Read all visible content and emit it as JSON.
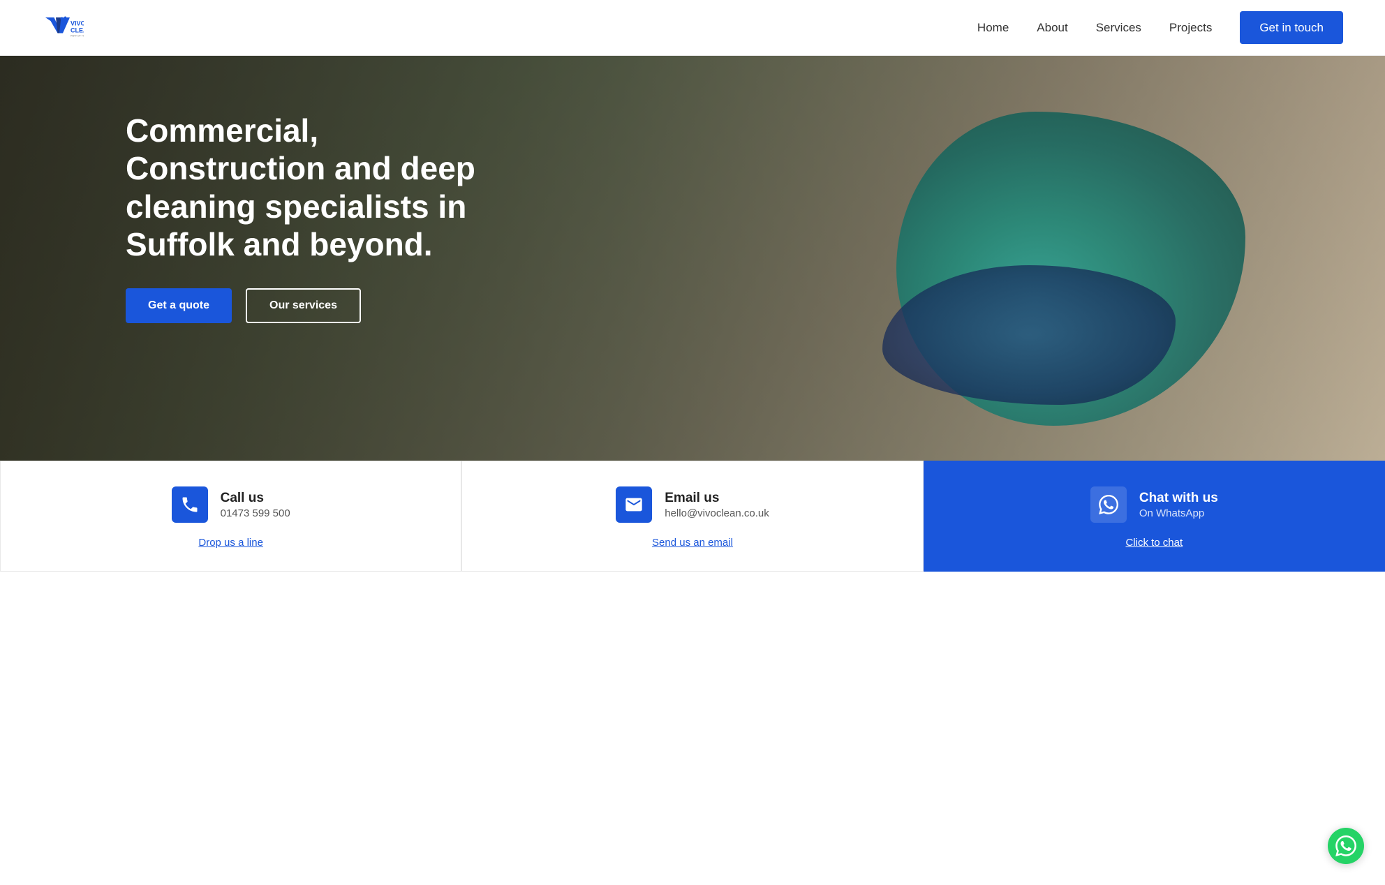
{
  "brand": {
    "name": "VIVO CLEAN",
    "tagline": "PART OF THE VIVO GROUP"
  },
  "nav": {
    "links": [
      {
        "label": "Home",
        "id": "home"
      },
      {
        "label": "About",
        "id": "about"
      },
      {
        "label": "Services",
        "id": "services"
      },
      {
        "label": "Projects",
        "id": "projects"
      }
    ],
    "cta_label": "Get in touch"
  },
  "hero": {
    "title": "Commercial, Construction and deep cleaning specialists in Suffolk and beyond.",
    "btn_quote": "Get a quote",
    "btn_services": "Our services"
  },
  "contact": {
    "cards": [
      {
        "id": "call",
        "title": "Call us",
        "subtitle": "01473 599 500",
        "link": "Drop us a line",
        "icon": "phone"
      },
      {
        "id": "email",
        "title": "Email us",
        "subtitle": "hello@vivoclean.co.uk",
        "link": "Send us an email",
        "icon": "email"
      },
      {
        "id": "chat",
        "title": "Chat with us",
        "subtitle": "On WhatsApp",
        "link": "Click to chat",
        "icon": "whatsapp"
      }
    ]
  }
}
